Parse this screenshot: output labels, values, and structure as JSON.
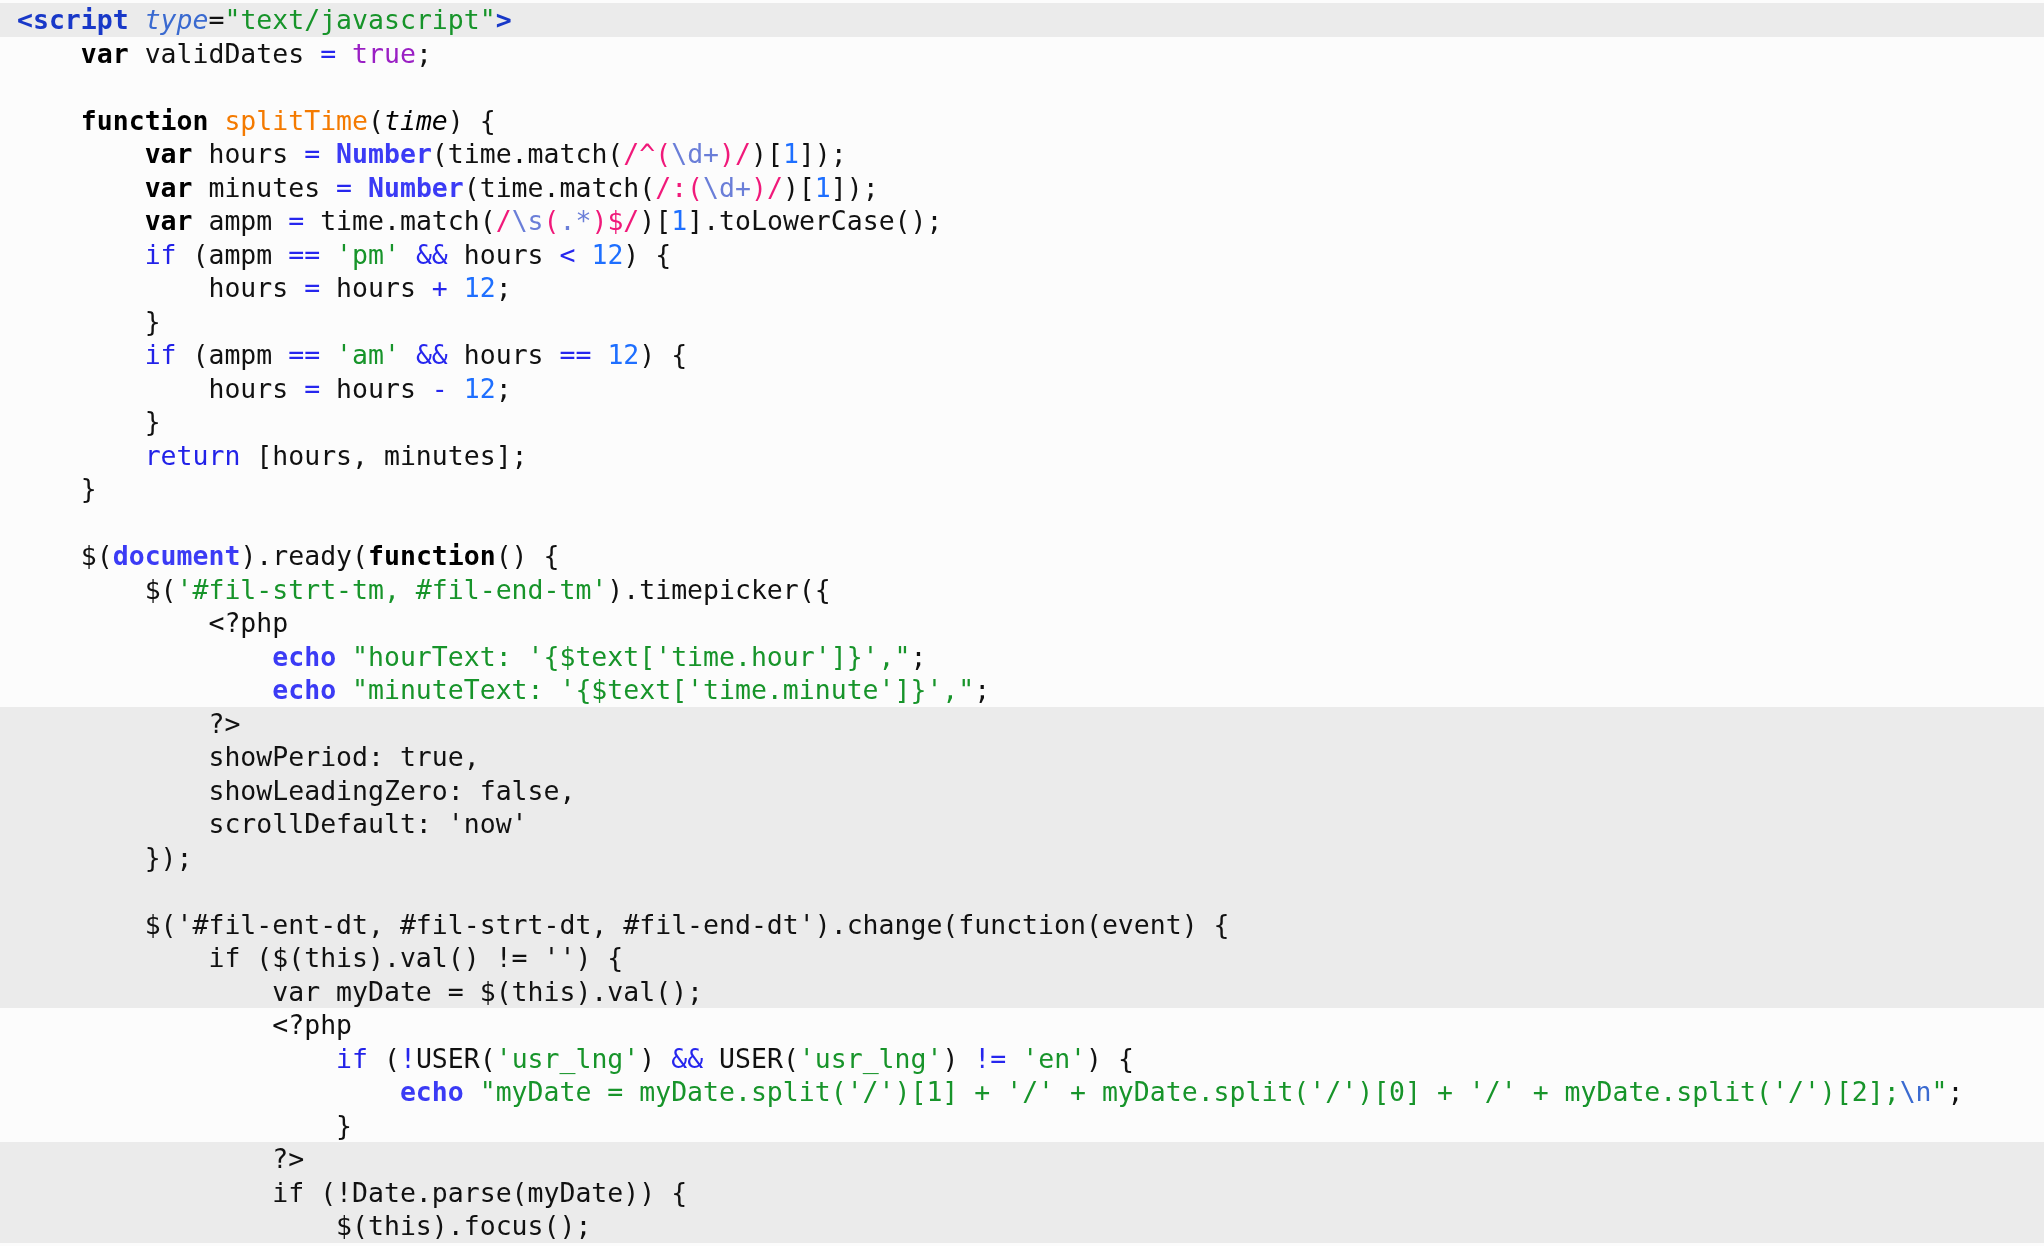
{
  "editor": {
    "blocks": [
      {
        "shaded": true,
        "lines": [
          {
            "gap_after": false,
            "tokens": [
              {
                "kind": "tag",
                "text": "<script"
              },
              {
                "kind": "attr",
                "text": " type"
              },
              {
                "kind": "p",
                "text": "="
              },
              {
                "kind": "str",
                "text": "\"text/javascript\""
              },
              {
                "kind": "tag",
                "text": ">"
              }
            ]
          }
        ]
      },
      {
        "shaded": false,
        "lines": [
          {
            "gap_after": true,
            "tokens": [
              {
                "kind": "kw",
                "text": "    var"
              },
              {
                "kind": "p",
                "text": " validDates "
              },
              {
                "kind": "op",
                "text": "= "
              },
              {
                "kind": "bool",
                "text": "true"
              },
              {
                "kind": "p",
                "text": ";"
              }
            ]
          },
          {
            "gap_after": false,
            "tokens": [
              {
                "kind": "kw",
                "text": "    function"
              },
              {
                "kind": "fn",
                "text": " splitTime"
              },
              {
                "kind": "p",
                "text": "("
              },
              {
                "kind": "param",
                "text": "time"
              },
              {
                "kind": "p",
                "text": ") {"
              }
            ]
          },
          {
            "gap_after": false,
            "tokens": [
              {
                "kind": "kw",
                "text": "        var"
              },
              {
                "kind": "p",
                "text": " hours "
              },
              {
                "kind": "op",
                "text": "= "
              },
              {
                "kind": "bi",
                "text": "Number"
              },
              {
                "kind": "p",
                "text": "(time.match("
              },
              {
                "kind": "rx",
                "text": "/^("
              },
              {
                "kind": "rxi",
                "text": "\\d+"
              },
              {
                "kind": "rx",
                "text": ")/"
              },
              {
                "kind": "p",
                "text": ")["
              },
              {
                "kind": "num",
                "text": "1"
              },
              {
                "kind": "p",
                "text": "]);"
              }
            ]
          },
          {
            "gap_after": false,
            "tokens": [
              {
                "kind": "kw",
                "text": "        var"
              },
              {
                "kind": "p",
                "text": " minutes "
              },
              {
                "kind": "op",
                "text": "= "
              },
              {
                "kind": "bi",
                "text": "Number"
              },
              {
                "kind": "p",
                "text": "(time.match("
              },
              {
                "kind": "rx",
                "text": "/:("
              },
              {
                "kind": "rxi",
                "text": "\\d+"
              },
              {
                "kind": "rx",
                "text": ")/"
              },
              {
                "kind": "p",
                "text": ")["
              },
              {
                "kind": "num",
                "text": "1"
              },
              {
                "kind": "p",
                "text": "]);"
              }
            ]
          },
          {
            "gap_after": false,
            "tokens": [
              {
                "kind": "kw",
                "text": "        var"
              },
              {
                "kind": "p",
                "text": " ampm "
              },
              {
                "kind": "op",
                "text": "="
              },
              {
                "kind": "p",
                "text": " time.match("
              },
              {
                "kind": "rx",
                "text": "/"
              },
              {
                "kind": "rxi",
                "text": "\\s"
              },
              {
                "kind": "rx",
                "text": "("
              },
              {
                "kind": "rxi",
                "text": ".*"
              },
              {
                "kind": "rx",
                "text": ")$/"
              },
              {
                "kind": "p",
                "text": ")["
              },
              {
                "kind": "num",
                "text": "1"
              },
              {
                "kind": "p",
                "text": "].toLowerCase();"
              }
            ]
          },
          {
            "gap_after": false,
            "tokens": [
              {
                "kind": "kw2",
                "text": "        if"
              },
              {
                "kind": "p",
                "text": " (ampm "
              },
              {
                "kind": "op",
                "text": "== "
              },
              {
                "kind": "str",
                "text": "'pm'"
              },
              {
                "kind": "op",
                "text": " &&"
              },
              {
                "kind": "p",
                "text": " hours "
              },
              {
                "kind": "op",
                "text": "< "
              },
              {
                "kind": "num",
                "text": "12"
              },
              {
                "kind": "p",
                "text": ") {"
              }
            ]
          },
          {
            "gap_after": false,
            "tokens": [
              {
                "kind": "p",
                "text": "            hours "
              },
              {
                "kind": "op",
                "text": "="
              },
              {
                "kind": "p",
                "text": " hours "
              },
              {
                "kind": "op",
                "text": "+ "
              },
              {
                "kind": "num",
                "text": "12"
              },
              {
                "kind": "p",
                "text": ";"
              }
            ]
          },
          {
            "gap_after": false,
            "tokens": [
              {
                "kind": "p",
                "text": "        }"
              }
            ]
          },
          {
            "gap_after": false,
            "tokens": [
              {
                "kind": "kw2",
                "text": "        if"
              },
              {
                "kind": "p",
                "text": " (ampm "
              },
              {
                "kind": "op",
                "text": "== "
              },
              {
                "kind": "str",
                "text": "'am'"
              },
              {
                "kind": "op",
                "text": " &&"
              },
              {
                "kind": "p",
                "text": " hours "
              },
              {
                "kind": "op",
                "text": "== "
              },
              {
                "kind": "num",
                "text": "12"
              },
              {
                "kind": "p",
                "text": ") {"
              }
            ]
          },
          {
            "gap_after": false,
            "tokens": [
              {
                "kind": "p",
                "text": "            hours "
              },
              {
                "kind": "op",
                "text": "="
              },
              {
                "kind": "p",
                "text": " hours "
              },
              {
                "kind": "op",
                "text": "- "
              },
              {
                "kind": "num",
                "text": "12"
              },
              {
                "kind": "p",
                "text": ";"
              }
            ]
          },
          {
            "gap_after": false,
            "tokens": [
              {
                "kind": "p",
                "text": "        }"
              }
            ]
          },
          {
            "gap_after": false,
            "tokens": [
              {
                "kind": "kw2",
                "text": "        return"
              },
              {
                "kind": "p",
                "text": " [hours, minutes];"
              }
            ]
          },
          {
            "gap_after": true,
            "tokens": [
              {
                "kind": "p",
                "text": "    }"
              }
            ]
          },
          {
            "gap_after": false,
            "tokens": [
              {
                "kind": "p",
                "text": "    $("
              },
              {
                "kind": "bi",
                "text": "document"
              },
              {
                "kind": "p",
                "text": ").ready("
              },
              {
                "kind": "kw",
                "text": "function"
              },
              {
                "kind": "p",
                "text": "() {"
              }
            ]
          },
          {
            "gap_after": false,
            "tokens": [
              {
                "kind": "p",
                "text": "        $("
              },
              {
                "kind": "str",
                "text": "'#fil-strt-tm, #fil-end-tm'"
              },
              {
                "kind": "p",
                "text": ").timepicker({"
              }
            ]
          },
          {
            "gap_after": false,
            "tokens": [
              {
                "kind": "p",
                "text": "            <?php"
              }
            ]
          },
          {
            "gap_after": false,
            "tokens": [
              {
                "kind": "bi",
                "text": "                echo"
              },
              {
                "kind": "str",
                "text": " \"hourText: '{$text['time.hour']}',\""
              },
              {
                "kind": "p",
                "text": ";"
              }
            ]
          },
          {
            "gap_after": false,
            "tokens": [
              {
                "kind": "bi",
                "text": "                echo"
              },
              {
                "kind": "str",
                "text": " \"minuteText: '{$text['time.minute']}',\""
              },
              {
                "kind": "p",
                "text": ";"
              }
            ]
          }
        ]
      },
      {
        "shaded": true,
        "lines": [
          {
            "gap_after": false,
            "tokens": [
              {
                "kind": "p",
                "text": "            ?>"
              }
            ]
          },
          {
            "gap_after": false,
            "tokens": [
              {
                "kind": "p",
                "text": "            showPeriod: true,"
              }
            ]
          },
          {
            "gap_after": false,
            "tokens": [
              {
                "kind": "p",
                "text": "            showLeadingZero: false,"
              }
            ]
          },
          {
            "gap_after": false,
            "tokens": [
              {
                "kind": "p",
                "text": "            scrollDefault: 'now'"
              }
            ]
          },
          {
            "gap_after": true,
            "tokens": [
              {
                "kind": "p",
                "text": "        });"
              }
            ]
          },
          {
            "gap_after": false,
            "tokens": [
              {
                "kind": "p",
                "text": "        $('#fil-ent-dt, #fil-strt-dt, #fil-end-dt').change(function(event) {"
              }
            ]
          },
          {
            "gap_after": false,
            "tokens": [
              {
                "kind": "p",
                "text": "            if ($(this).val() != '') {"
              }
            ]
          },
          {
            "gap_after": false,
            "tokens": [
              {
                "kind": "p",
                "text": "                var myDate = $(this).val();"
              }
            ]
          }
        ]
      },
      {
        "shaded": false,
        "lines": [
          {
            "gap_after": false,
            "tokens": [
              {
                "kind": "p",
                "text": "                <?php"
              }
            ]
          },
          {
            "gap_after": false,
            "tokens": [
              {
                "kind": "kw2",
                "text": "                    if"
              },
              {
                "kind": "p",
                "text": " ("
              },
              {
                "kind": "op",
                "text": "!"
              },
              {
                "kind": "p",
                "text": "USER("
              },
              {
                "kind": "str",
                "text": "'usr_lng'"
              },
              {
                "kind": "p",
                "text": ") "
              },
              {
                "kind": "op",
                "text": "&&"
              },
              {
                "kind": "p",
                "text": " USER("
              },
              {
                "kind": "str",
                "text": "'usr_lng'"
              },
              {
                "kind": "p",
                "text": ") "
              },
              {
                "kind": "op",
                "text": "!= "
              },
              {
                "kind": "str",
                "text": "'en'"
              },
              {
                "kind": "p",
                "text": ") {"
              }
            ]
          },
          {
            "gap_after": false,
            "tokens": [
              {
                "kind": "bi",
                "text": "                        echo"
              },
              {
                "kind": "str",
                "text": " \"myDate = myDate.split('/')[1] + '/' + myDate.split('/')[0] + '/' + myDate.split('/')[2];"
              },
              {
                "kind": "esc",
                "text": "\\n"
              },
              {
                "kind": "str",
                "text": "\""
              },
              {
                "kind": "p",
                "text": ";"
              }
            ]
          },
          {
            "gap_after": false,
            "tokens": [
              {
                "kind": "p",
                "text": "                    }"
              }
            ]
          }
        ]
      },
      {
        "shaded": true,
        "lines": [
          {
            "gap_after": false,
            "tokens": [
              {
                "kind": "p",
                "text": "                ?>"
              }
            ]
          },
          {
            "gap_after": false,
            "tokens": [
              {
                "kind": "p",
                "text": "                if (!Date.parse(myDate)) {"
              }
            ]
          },
          {
            "gap_after": false,
            "tokens": [
              {
                "kind": "p",
                "text": "                    $(this).focus();"
              }
            ]
          }
        ]
      }
    ]
  }
}
